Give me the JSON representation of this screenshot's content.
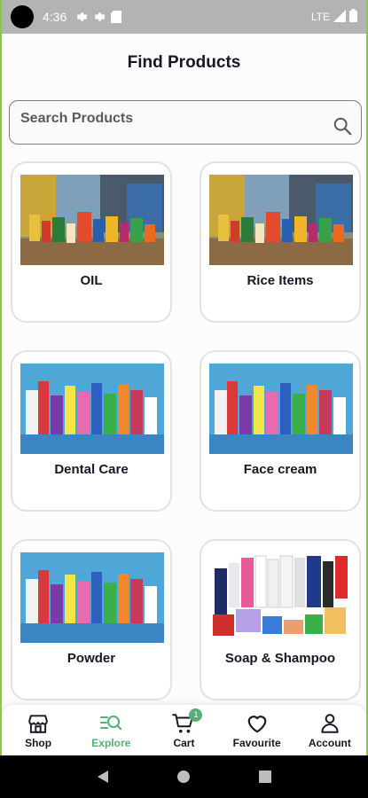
{
  "status_bar": {
    "time": "4:36",
    "network": "LTE"
  },
  "header": {
    "title": "Find Products"
  },
  "search": {
    "placeholder": "Search Products"
  },
  "categories": [
    {
      "label": "OIL",
      "image": "grocery-shelf-photo"
    },
    {
      "label": "Rice Items",
      "image": "grocery-shelf-photo"
    },
    {
      "label": "Dental Care",
      "image": "detergent-products-photo"
    },
    {
      "label": "Face cream",
      "image": "detergent-products-photo"
    },
    {
      "label": "Powder",
      "image": "detergent-products-photo"
    },
    {
      "label": "Soap & Shampoo",
      "image": "toiletries-products-photo"
    }
  ],
  "bottom_nav": {
    "items": [
      {
        "label": "Shop",
        "icon": "store-icon",
        "active": false
      },
      {
        "label": "Explore",
        "icon": "explore-icon",
        "active": true
      },
      {
        "label": "Cart",
        "icon": "cart-icon",
        "active": false,
        "badge": "1"
      },
      {
        "label": "Favourite",
        "icon": "heart-icon",
        "active": false
      },
      {
        "label": "Account",
        "icon": "user-icon",
        "active": false
      }
    ]
  },
  "colors": {
    "accent": "#53b175",
    "status_bar": "#b3b3b3",
    "frame_border": "#8dc63f"
  }
}
